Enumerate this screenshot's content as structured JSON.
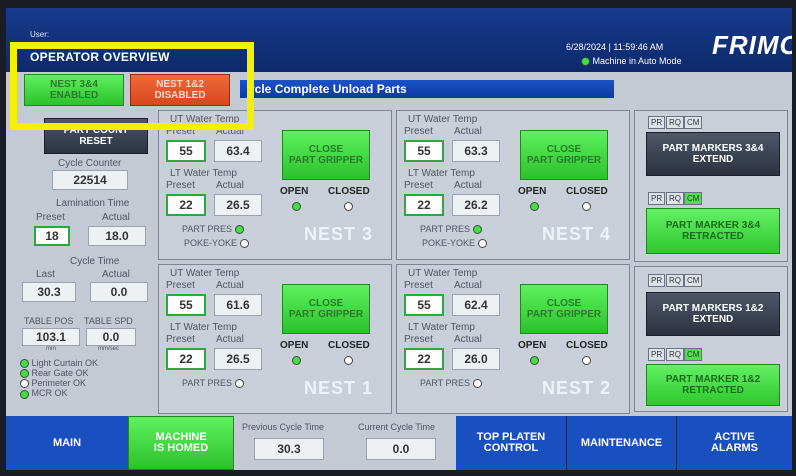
{
  "header": {
    "user_label": "User:",
    "screen_title": "OPERATOR OVERVIEW",
    "datetime": "6/28/2024 | 11:59:46 AM",
    "mode": "Machine in Auto Mode",
    "logo": "FRIMO"
  },
  "nest_status": {
    "nest34": "NEST 3&4\nENABLED",
    "nest12": "NEST 1&2\nDISABLED"
  },
  "status_message": "ycle Complete Unload Parts",
  "left": {
    "part_count_reset": "PART COUNT\nRESET",
    "cycle_counter_label": "Cycle Counter",
    "cycle_counter": "22514",
    "lamination_time_label": "Lamination Time",
    "preset_label": "Preset",
    "actual_label": "Actual",
    "lam_preset": "18",
    "lam_actual": "18.0",
    "cycle_time_label": "Cycle Time",
    "last_label": "Last",
    "ct_last": "30.3",
    "ct_actual": "0.0",
    "table_pos_label": "TABLE POS",
    "table_spd_label": "TABLE SPD",
    "table_pos": "103.1",
    "table_spd": "0.0",
    "unit_mm": "mm",
    "unit_mms": "mm/sec",
    "safety": [
      "Light Curtain OK",
      "Rear Gate OK",
      "Perimeter OK",
      "MCR OK"
    ]
  },
  "nest_labels": {
    "ut_water": "UT Water Temp",
    "lt_water": "LT Water Temp",
    "preset": "Preset",
    "actual": "Actual",
    "close_gripper": "CLOSE\nPART GRIPPER",
    "open": "OPEN",
    "closed": "CLOSED",
    "part_pres": "PART PRES",
    "poke_yoke": "POKE-YOKE"
  },
  "nest3": {
    "name": "NEST 3",
    "ut_preset": "55",
    "ut_actual": "63.4",
    "lt_preset": "22",
    "lt_actual": "26.5"
  },
  "nest4": {
    "name": "NEST 4",
    "ut_preset": "55",
    "ut_actual": "63.3",
    "lt_preset": "22",
    "lt_actual": "26.2"
  },
  "nest1": {
    "name": "NEST 1",
    "ut_preset": "55",
    "ut_actual": "61.6",
    "lt_preset": "22",
    "lt_actual": "26.5"
  },
  "nest2": {
    "name": "NEST 2",
    "ut_preset": "55",
    "ut_actual": "62.4",
    "lt_preset": "22",
    "lt_actual": "26.0"
  },
  "markers": {
    "pr": "PR",
    "rq": "RQ",
    "cm": "CM",
    "m34_extend": "PART MARKERS 3&4\nEXTEND",
    "m34_retracted": "PART MARKER 3&4\nRETRACTED",
    "m12_extend": "PART MARKERS 1&2\nEXTEND",
    "m12_retracted": "PART MARKER 1&2\nRETRACTED"
  },
  "footer": {
    "main": "MAIN",
    "homed": "MACHINE\nIS HOMED",
    "prev_label": "Previous Cycle Time",
    "prev_value": "30.3",
    "curr_label": "Current Cycle Time",
    "curr_value": "0.0",
    "top_platen": "TOP PLATEN\nCONTROL",
    "maintenance": "MAINTENANCE",
    "alarms": "ACTIVE\nALARMS"
  }
}
